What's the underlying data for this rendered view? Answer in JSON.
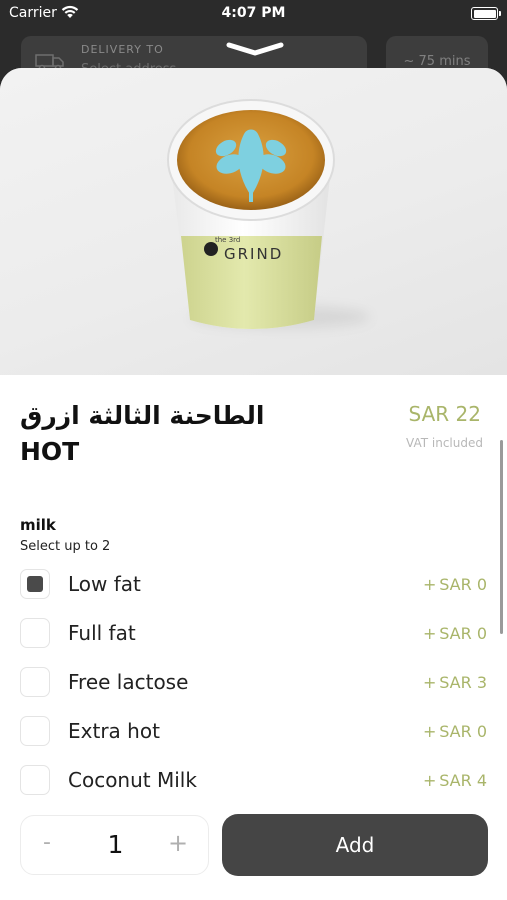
{
  "status_bar": {
    "carrier": "Carrier",
    "time": "4:07 PM"
  },
  "background_header": {
    "delivery_label": "DELIVERY TO",
    "delivery_value": "Select address",
    "eta": "~ 75 mins"
  },
  "product": {
    "title_ar": "الطاحنة الثالثة ازرق",
    "title_en": "HOT",
    "price": "SAR 22",
    "vat_note": "VAT included",
    "image_alt": "Coffee cup with latte art",
    "cup_brand": "GRIND",
    "cup_brand_small": "the 3rd"
  },
  "option_group": {
    "title": "milk",
    "subtitle": "Select up to 2",
    "options": [
      {
        "label": "Low fat",
        "plus": "+",
        "price": "SAR 0",
        "checked": true
      },
      {
        "label": "Full fat",
        "plus": "+",
        "price": "SAR 0",
        "checked": false
      },
      {
        "label": "Free lactose",
        "plus": "+",
        "price": "SAR 3",
        "checked": false
      },
      {
        "label": "Extra hot",
        "plus": "+",
        "price": "SAR 0",
        "checked": false
      },
      {
        "label": "Coconut Milk",
        "plus": "+",
        "price": "SAR 4",
        "checked": false
      }
    ]
  },
  "quantity": {
    "minus": "-",
    "value": "1",
    "plus": "+"
  },
  "add_button": {
    "label": "Add"
  },
  "colors": {
    "accent": "#a9b56a",
    "button": "#454545",
    "cup_sleeve": "#dfe6a8"
  }
}
